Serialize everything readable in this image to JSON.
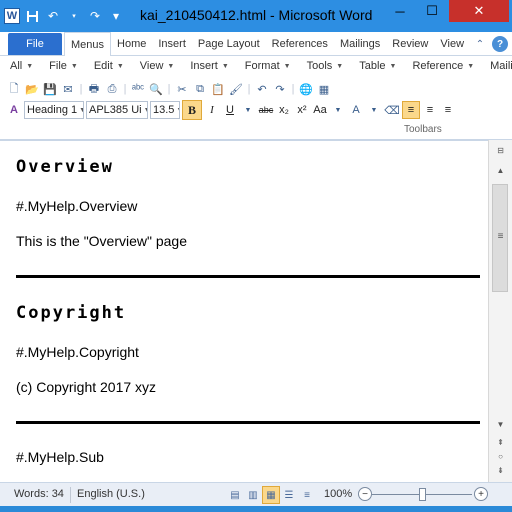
{
  "window": {
    "title": "kai_210450412.html - Microsoft Word",
    "app_icon": "W",
    "minimize": "─",
    "maximize": "☐",
    "close": "✕"
  },
  "qat": {
    "save_icon": "💾",
    "undo_icon": "↶",
    "redo_icon": "↷",
    "customize_icon": "▾"
  },
  "ribbon_tabs": {
    "file": "File",
    "tabs": [
      "Menus",
      "Home",
      "Insert",
      "Page Layout",
      "References",
      "Mailings",
      "Review",
      "View"
    ],
    "active": "Menus"
  },
  "menubar": [
    "All",
    "File",
    "Edit",
    "View",
    "Insert",
    "Format",
    "Tools",
    "Table",
    "Reference",
    "Mailing"
  ],
  "toolbar": {
    "style_value": "Heading 1",
    "font_value": "APL385 Ui",
    "size_value": "13.5",
    "bold": "B",
    "italic": "I",
    "underline": "U",
    "strike": "abc",
    "subscript": "x₂",
    "superscript": "x²",
    "change_case": "Aa",
    "group_label": "Toolbars"
  },
  "document": {
    "sections": [
      {
        "heading": "Overview",
        "ref": "#.MyHelp.Overview",
        "text": "This is the \"Overview\" page"
      },
      {
        "heading": "Copyright",
        "ref": "#.MyHelp.Copyright",
        "text": "(c) Copyright 2017 xyz"
      },
      {
        "heading": "",
        "ref": "#.MyHelp.Sub",
        "text": ""
      }
    ]
  },
  "statusbar": {
    "words": "Words: 34",
    "language": "English (U.S.)",
    "zoom": "100%",
    "zoom_minus": "−",
    "zoom_plus": "+"
  },
  "colors": {
    "title_bar": "#2d8ee2",
    "file_tab": "#2b6fcf",
    "close_button": "#c7302b",
    "active_highlight": "#fbd88b"
  }
}
